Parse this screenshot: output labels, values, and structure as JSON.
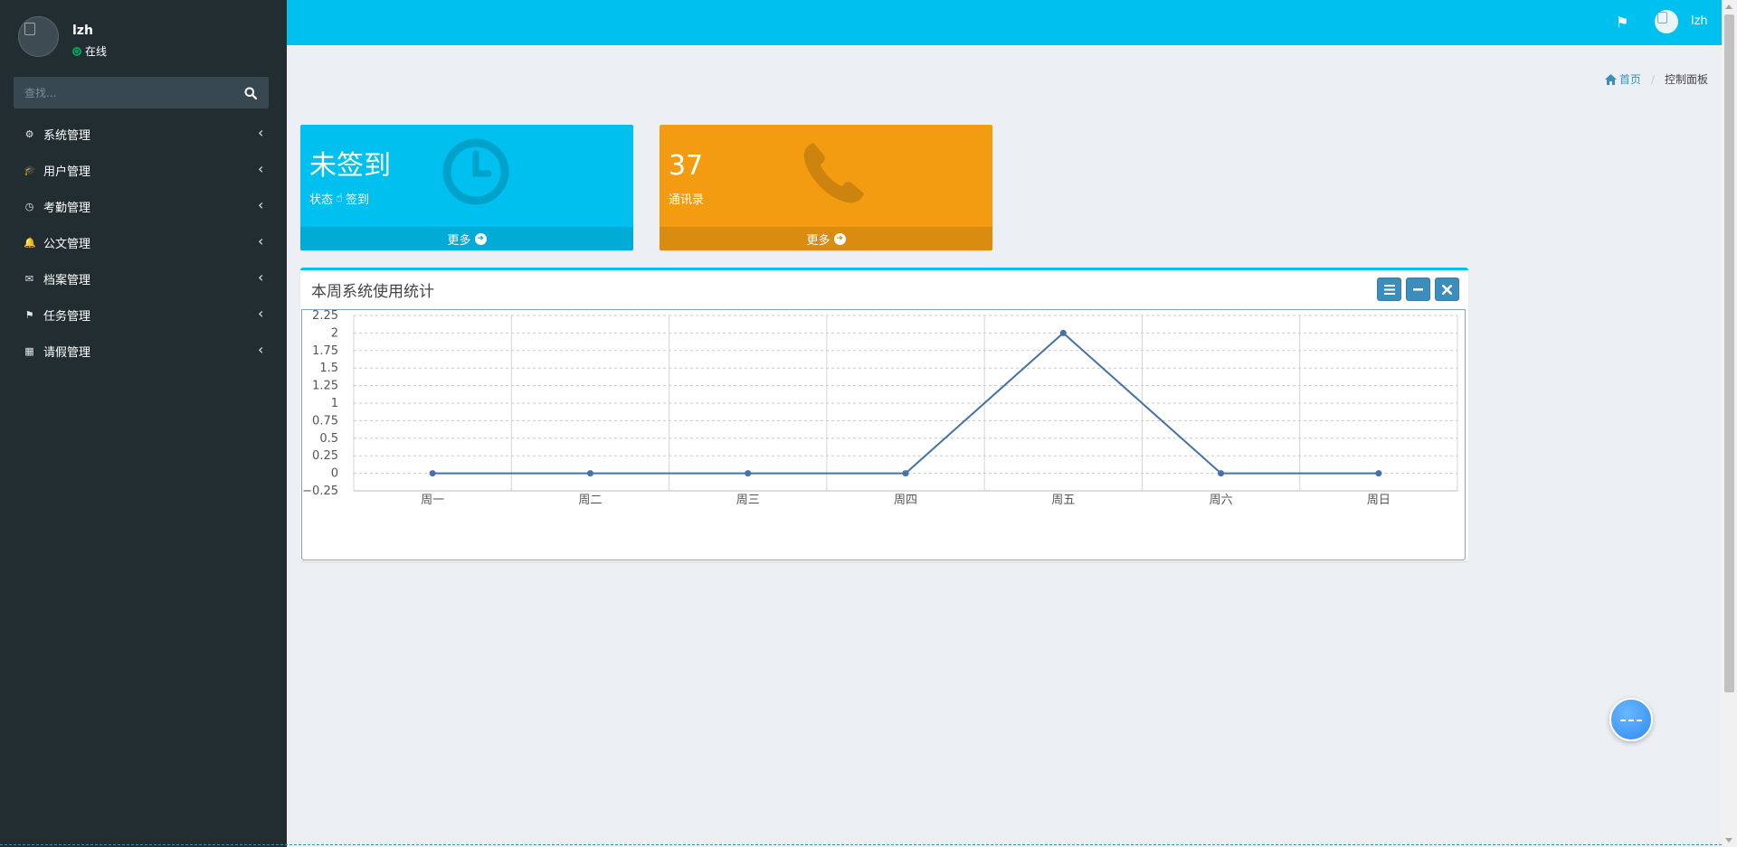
{
  "user": {
    "name": "lzh",
    "status": "在线"
  },
  "search": {
    "placeholder": "查找..."
  },
  "menu": [
    {
      "label": "系统管理",
      "icon": "gear-icon"
    },
    {
      "label": "用户管理",
      "icon": "graduation-cap-icon"
    },
    {
      "label": "考勤管理",
      "icon": "clock-icon"
    },
    {
      "label": "公文管理",
      "icon": "bell-icon"
    },
    {
      "label": "档案管理",
      "icon": "envelope-icon"
    },
    {
      "label": "任务管理",
      "icon": "flag-icon"
    },
    {
      "label": "请假管理",
      "icon": "calendar-icon"
    }
  ],
  "header": {
    "username": "lzh",
    "accent": "#00c0ef"
  },
  "breadcrumb": {
    "home": "首页",
    "current": "控制面板"
  },
  "boxes": {
    "checkin": {
      "value": "未签到",
      "label_prefix": "状态",
      "action": "签到",
      "footer": "更多",
      "color": "#00c0ef"
    },
    "contacts": {
      "value": "37",
      "label": "通讯录",
      "footer": "更多",
      "color": "#f39c12"
    }
  },
  "chart_box": {
    "title": "本周系统使用统计"
  },
  "chart_data": {
    "type": "line",
    "categories": [
      "周一",
      "周二",
      "周三",
      "周四",
      "周五",
      "周六",
      "周日"
    ],
    "values": [
      0,
      0,
      0,
      0,
      2,
      0,
      0
    ],
    "ylim": [
      -0.25,
      2.25
    ],
    "yticks": [
      -0.25,
      0,
      0.25,
      0.5,
      0.75,
      1,
      1.25,
      1.5,
      1.75,
      2,
      2.25
    ],
    "ytick_labels": [
      "−0.25",
      "0",
      "0.25",
      "0.5",
      "0.75",
      "1",
      "1.25",
      "1.5",
      "1.75",
      "2",
      "2.25"
    ],
    "grid": true,
    "line_color": "#4572a7"
  }
}
